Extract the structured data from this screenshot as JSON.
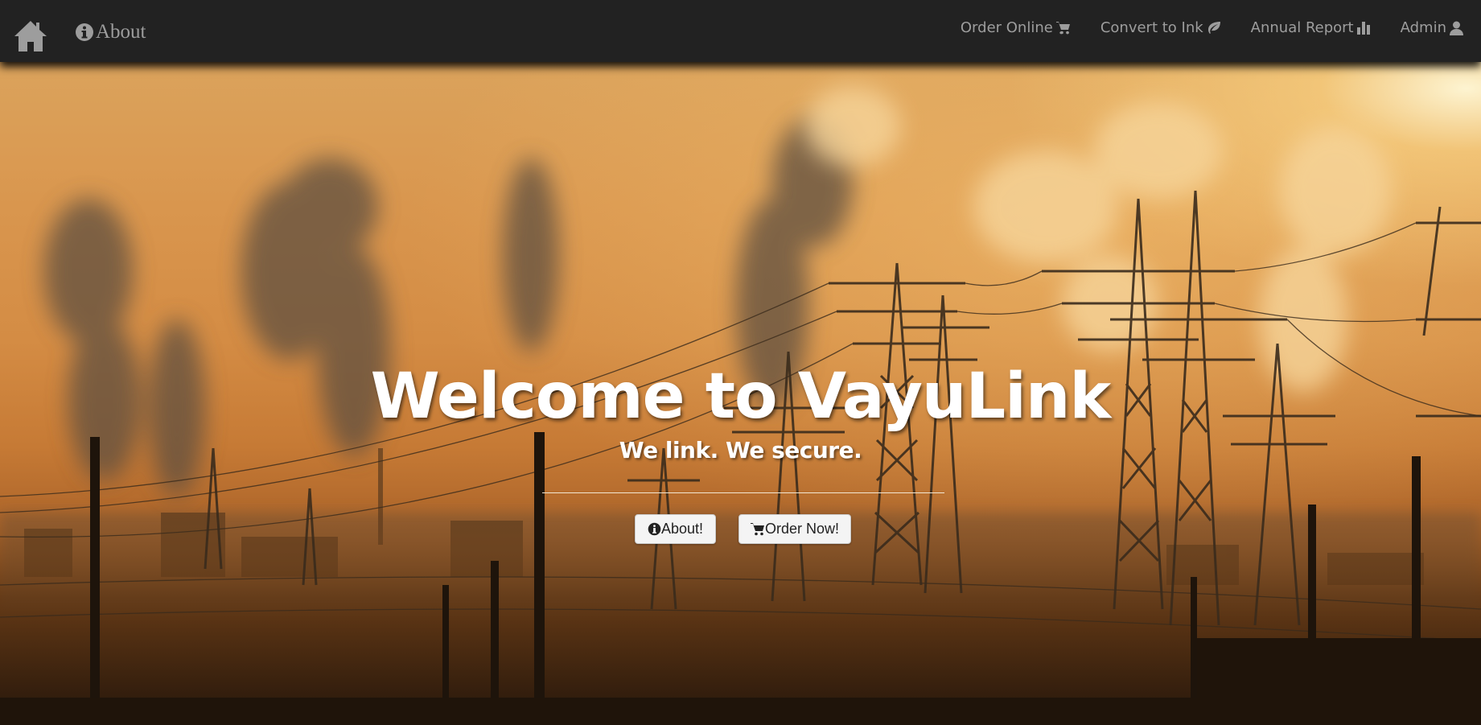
{
  "navbar": {
    "about_label": "About",
    "links": [
      {
        "label": "Order Online",
        "icon": "shopping-cart-icon"
      },
      {
        "label": "Convert to Ink",
        "icon": "leaf-icon"
      },
      {
        "label": "Annual Report",
        "icon": "bar-chart-icon"
      },
      {
        "label": "Admin",
        "icon": "user-icon"
      }
    ],
    "icons": {
      "home": "home-icon",
      "about": "info-circle-icon"
    }
  },
  "hero": {
    "title": "Welcome to VayuLink",
    "subtitle": "We link. We secure.",
    "buttons": {
      "about_label": "About!",
      "order_label": "Order Now!"
    },
    "background_image": "industrial smokestacks and power pylons at sunset"
  },
  "colors": {
    "navbar_bg": "#222222",
    "nav_text": "#9d9d9d",
    "hero_text": "#ffffff",
    "sky_orange": "#d48c44"
  }
}
